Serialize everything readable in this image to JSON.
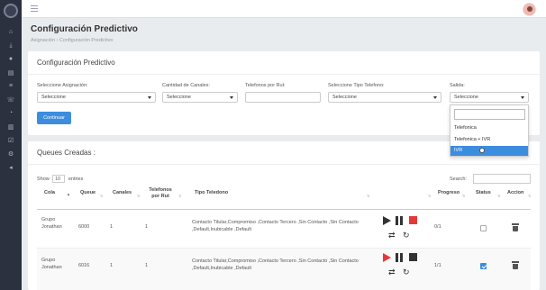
{
  "page": {
    "title": "Configuración Predictivo",
    "breadcrumb": [
      "Asignación",
      "Configuración Predictivo"
    ]
  },
  "sidebar_icons": [
    "home-icon",
    "download-icon",
    "user-icon",
    "layers-icon",
    "list-icon",
    "phone-icon",
    "chart-icon",
    "bar-chart-icon",
    "check-icon",
    "settings-icon",
    "volume-icon"
  ],
  "config": {
    "title": "Configuración Predictivo",
    "fields": {
      "asignacion": {
        "label": "Seleccione Asignación:",
        "value": "Seleccione"
      },
      "canales": {
        "label": "Cantidad de Canales:",
        "value": "Seleccione"
      },
      "telefonos_rut": {
        "label": "Telefonos por Rut:",
        "value": ""
      },
      "tipo_telefono": {
        "label": "Seleccione Tipo Telefono:",
        "value": "Seleccione"
      },
      "salida": {
        "label": "Salida:",
        "value": "Seleccione"
      }
    },
    "button": "Continuar",
    "salida_options": [
      "Telefonica",
      "Telefonica + IVR",
      "IVR"
    ],
    "salida_highlighted": "IVR"
  },
  "queues": {
    "title": "Queues Creadas :",
    "show_label": "Show",
    "show_value": "10",
    "entries_label": "entries",
    "search_label": "Search:",
    "columns": [
      "Cola",
      "Queue",
      "Canales",
      "Telefonos por Rut",
      "Tipo Teledono",
      "",
      "Progreso",
      "Status",
      "Accion"
    ],
    "rows": [
      {
        "cola": "Grupo Jonathan",
        "queue": "6000",
        "canales": "1",
        "telefonos_rut": "1",
        "tipo": "Contacto Titular,Compromiso ,Contacto Tercero ,Sin Contacto ,Sin Contacto ,Default,Inubicable ,Default",
        "progreso": "0/1",
        "status": false,
        "play_active": false
      },
      {
        "cola": "Grupo Jonathan",
        "queue": "6016",
        "canales": "1",
        "telefonos_rut": "1",
        "tipo": "Contacto Titular,Compromiso ,Contacto Tercero ,Sin Contacto ,Sin Contacto ,Default,Inubicable ,Default",
        "progreso": "1/1",
        "status": true,
        "play_active": true
      }
    ]
  },
  "colors": {
    "accent": "#3c8dde",
    "sidebar": "#2c3140",
    "red": "#e53935"
  }
}
